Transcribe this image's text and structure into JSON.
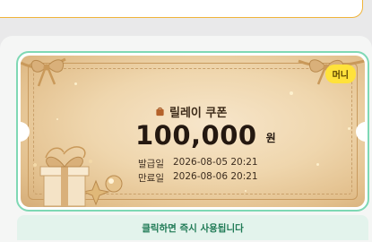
{
  "coupon": {
    "badge": "머니",
    "bag_icon": "shopping-bag-icon",
    "title": "릴레이 쿠폰",
    "amount": "100,000",
    "unit": "원",
    "issued_label": "발급일",
    "issued_date": "2026-08-05 20:21",
    "expires_label": "만료일",
    "expires_date": "2026-08-06 20:21"
  },
  "action": {
    "label": "클릭하면 즉시 사용됩니다"
  },
  "colors": {
    "accent_border": "#7fd8b4",
    "badge": "#ffe23b",
    "action_text": "#1f7a55",
    "ticket_gold": "#efd6ad"
  }
}
